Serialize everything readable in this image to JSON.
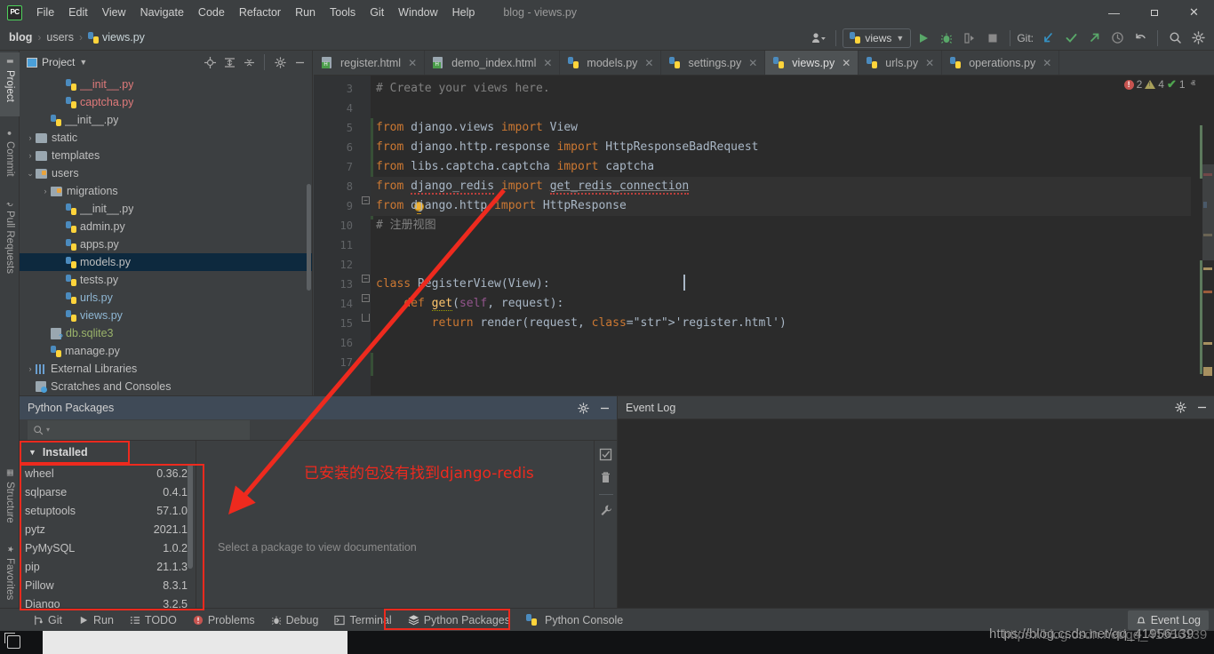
{
  "window": {
    "app_logo": "PC",
    "title": "blog - views.py",
    "minimize": "—",
    "maximize": "❐",
    "close": "✕"
  },
  "menubar": {
    "items": [
      "File",
      "Edit",
      "View",
      "Navigate",
      "Code",
      "Refactor",
      "Run",
      "Tools",
      "Git",
      "Window",
      "Help"
    ]
  },
  "breadcrumb": {
    "project": "blog",
    "folder": "users",
    "file": "views.py",
    "sep": "›"
  },
  "toolbar": {
    "profile_icon": "user-profile-icon",
    "run_config": "views",
    "run_icon": "▶",
    "debug_icon": "debug-bug-icon",
    "coverage_icon": "coverage-icon",
    "stop_icon": "■",
    "git_label": "Git:",
    "git_update_icon": "↙",
    "git_commit_icon": "✓",
    "git_push_icon": "↗",
    "history_icon": "◴",
    "rollback_icon": "↺",
    "search_icon": "⌕",
    "settings_icon": "⚙"
  },
  "vertical_tabs": {
    "left": [
      {
        "label": "Project",
        "selected": true
      },
      {
        "label": "Commit",
        "selected": false
      },
      {
        "label": "Pull Requests",
        "selected": false
      },
      {
        "label": "Structure",
        "selected": false
      },
      {
        "label": "Favorites",
        "selected": false
      }
    ]
  },
  "project_panel": {
    "title": "Project",
    "dropdown_icon": "▾",
    "actions": [
      "locate-icon",
      "expand-all-icon",
      "collapse-all-icon",
      "gear-icon",
      "minimize-icon"
    ],
    "tree": [
      {
        "label": "__init__.py",
        "indent": 4,
        "kind": "py",
        "color": "red",
        "arrow": ""
      },
      {
        "label": "captcha.py",
        "indent": 4,
        "kind": "py",
        "color": "red",
        "arrow": ""
      },
      {
        "label": "__init__.py",
        "indent": 3,
        "kind": "py",
        "color": "norm",
        "arrow": ""
      },
      {
        "label": "static",
        "indent": 2,
        "kind": "folder",
        "color": "norm",
        "arrow": "›"
      },
      {
        "label": "templates",
        "indent": 2,
        "kind": "folder",
        "color": "norm",
        "arrow": "›"
      },
      {
        "label": "users",
        "indent": 2,
        "kind": "src",
        "color": "norm",
        "arrow": "⌄"
      },
      {
        "label": "migrations",
        "indent": 3,
        "kind": "src",
        "color": "norm",
        "arrow": "›"
      },
      {
        "label": "__init__.py",
        "indent": 4,
        "kind": "py",
        "color": "norm",
        "arrow": ""
      },
      {
        "label": "admin.py",
        "indent": 4,
        "kind": "py",
        "color": "norm",
        "arrow": ""
      },
      {
        "label": "apps.py",
        "indent": 4,
        "kind": "py",
        "color": "norm",
        "arrow": ""
      },
      {
        "label": "models.py",
        "indent": 4,
        "kind": "py",
        "color": "norm",
        "arrow": "",
        "selected": true
      },
      {
        "label": "tests.py",
        "indent": 4,
        "kind": "py",
        "color": "norm",
        "arrow": ""
      },
      {
        "label": "urls.py",
        "indent": 4,
        "kind": "py",
        "color": "blue",
        "arrow": ""
      },
      {
        "label": "views.py",
        "indent": 4,
        "kind": "py",
        "color": "blue",
        "arrow": ""
      },
      {
        "label": "db.sqlite3",
        "indent": 3,
        "kind": "db",
        "color": "green",
        "arrow": ""
      },
      {
        "label": "manage.py",
        "indent": 3,
        "kind": "py",
        "color": "norm",
        "arrow": ""
      },
      {
        "label": "External Libraries",
        "indent": 2,
        "kind": "lib",
        "color": "norm",
        "arrow": "›"
      },
      {
        "label": "Scratches and Consoles",
        "indent": 2,
        "kind": "scratch",
        "color": "norm",
        "arrow": ""
      }
    ]
  },
  "editor": {
    "tabs": [
      {
        "label": "register.html",
        "kind": "html",
        "active": false
      },
      {
        "label": "demo_index.html",
        "kind": "html",
        "active": false
      },
      {
        "label": "models.py",
        "kind": "py",
        "active": false
      },
      {
        "label": "settings.py",
        "kind": "py",
        "active": false
      },
      {
        "label": "views.py",
        "kind": "py",
        "active": true
      },
      {
        "label": "urls.py",
        "kind": "py",
        "active": false
      },
      {
        "label": "operations.py",
        "kind": "py",
        "active": false
      }
    ],
    "close_glyph": "✕",
    "first_line_number": 3,
    "line_numbers": [
      3,
      4,
      5,
      6,
      7,
      8,
      9,
      10,
      11,
      12,
      13,
      14,
      15,
      16,
      17
    ],
    "lines": [
      {
        "n": 3,
        "text": "# Create your views here."
      },
      {
        "n": 4,
        "text": ""
      },
      {
        "n": 5,
        "text": "from django.views import View"
      },
      {
        "n": 6,
        "text": "from django.http.response import HttpResponseBadRequest"
      },
      {
        "n": 7,
        "text": "from libs.captcha.captcha import captcha"
      },
      {
        "n": 8,
        "text": "from django_redis import get_redis_connection"
      },
      {
        "n": 9,
        "text": "from django.http import HttpResponse"
      },
      {
        "n": 10,
        "text": "# 注册视图"
      },
      {
        "n": 11,
        "text": ""
      },
      {
        "n": 12,
        "text": ""
      },
      {
        "n": 13,
        "text": "class RegisterView(View):"
      },
      {
        "n": 14,
        "text": "    def get(self, request):"
      },
      {
        "n": 15,
        "text": "        return render(request, 'register.html')"
      },
      {
        "n": 16,
        "text": ""
      },
      {
        "n": 17,
        "text": ""
      }
    ],
    "inspections": {
      "error_count": "2",
      "warning_count": "4",
      "ok_count": "1",
      "prev_icon": "ⱏ",
      "next_icon": "ⱟ"
    }
  },
  "python_packages": {
    "title": "Python Packages",
    "gear_icon": "⚙",
    "minimize_icon": "—",
    "search_placeholder": "",
    "search_glyph": "⌕",
    "search_dropdown": "▾",
    "installed_label": "Installed",
    "installed_caret": "▼",
    "packages": [
      {
        "name": "wheel",
        "version": "0.36.2"
      },
      {
        "name": "sqlparse",
        "version": "0.4.1"
      },
      {
        "name": "setuptools",
        "version": "57.1.0"
      },
      {
        "name": "pytz",
        "version": "2021.1"
      },
      {
        "name": "PyMySQL",
        "version": "1.0.2"
      },
      {
        "name": "pip",
        "version": "21.1.3"
      },
      {
        "name": "Pillow",
        "version": "8.3.1"
      },
      {
        "name": "Django",
        "version": "3.2.5"
      }
    ],
    "doc_placeholder": "Select a package to view documentation",
    "tools": [
      "install-checkbox-icon",
      "delete-trash-icon",
      "settings-wrench-icon"
    ]
  },
  "event_log": {
    "title": "Event Log",
    "gear_icon": "⚙",
    "minimize_icon": "—"
  },
  "status_bar": {
    "items": [
      {
        "label": "Git",
        "icon": "git-branch-icon"
      },
      {
        "label": "Run",
        "icon": "run-play-icon"
      },
      {
        "label": "TODO",
        "icon": "todo-list-icon"
      },
      {
        "label": "Problems",
        "icon": "problems-error-icon"
      },
      {
        "label": "Debug",
        "icon": "debug-bug-icon"
      },
      {
        "label": "Terminal",
        "icon": "terminal-icon"
      },
      {
        "label": "Python Packages",
        "icon": "packages-stack-icon",
        "active": true
      },
      {
        "label": "Python Console",
        "icon": "python-console-icon"
      }
    ],
    "event_log_label": "Event Log",
    "event_log_icon": "bell-icon"
  },
  "annotations": {
    "note_text": "已安装的包没有找到django-redis",
    "arrow_color": "#ee2a1e",
    "box_color": "#ee2a1e"
  },
  "watermark": {
    "url": "https://blog.csdn.net/qq_41956139"
  },
  "colors": {
    "ide_chrome": "#3c3f41",
    "editor_bg": "#2b2b2b",
    "gutter_bg": "#313335",
    "tab_active": "#4e5254",
    "tree_selected": "#0d293e",
    "panel_active_head": "#3f4a57",
    "accent_red": "#ee2a1e",
    "keyword_orange": "#cc7832",
    "string_green": "#6a8759",
    "comment_gray": "#808080",
    "text_default": "#a9b7c6"
  }
}
